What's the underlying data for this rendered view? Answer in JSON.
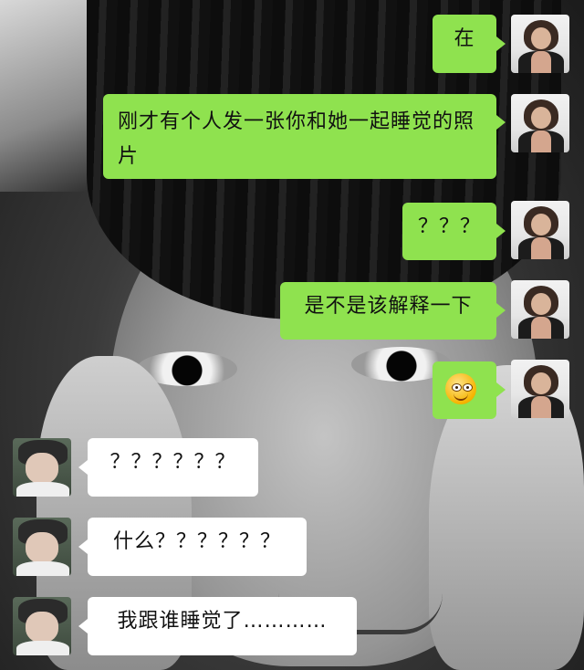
{
  "messages": [
    {
      "sender": "me",
      "text": "在"
    },
    {
      "sender": "me",
      "text": "刚才有个人发一张你和她一起睡觉的照片"
    },
    {
      "sender": "me",
      "text": "？？？"
    },
    {
      "sender": "me",
      "text": "是不是该解释一下"
    },
    {
      "sender": "me",
      "emoji": "grin-emoji"
    },
    {
      "sender": "them",
      "text": "？？？？？？"
    },
    {
      "sender": "them",
      "text": "什么？？？？？？"
    },
    {
      "sender": "them",
      "text": "我跟谁睡觉了…………"
    }
  ],
  "colors": {
    "my_bubble": "#8fe24f",
    "their_bubble": "#ffffff"
  }
}
